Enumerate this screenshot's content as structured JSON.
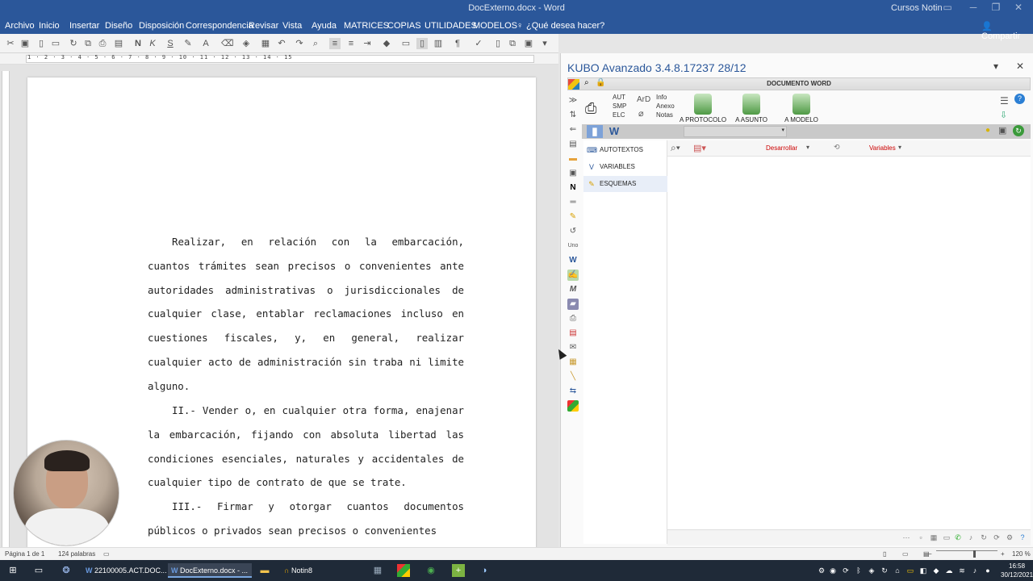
{
  "window": {
    "title": "DocExterno.docx - Word",
    "user": "Cursos Notin",
    "share": "Compartir"
  },
  "ribbon_tabs": [
    "Archivo",
    "Inicio",
    "Insertar",
    "Diseño",
    "Disposición",
    "Correspondencia",
    "Revisar",
    "Vista",
    "Ayuda",
    "MATRICES",
    "COPIAS",
    "UTILIDADES",
    "MODELOS",
    "¿Qué desea hacer?"
  ],
  "ruler_text": "1 · 2 · 3 · 4 · 5 · 6 · 7 · 8 · 9 · 10 · 11 · 12 · 13 · 14 · 15",
  "document": {
    "paragraphs": [
      "Realizar, en relación con la embarcación, cuantos trámites sean precisos o convenientes ante autoridades administrativas o jurisdiccionales de cualquier clase, entablar reclamaciones incluso en cuestiones fiscales, y, en general, realizar cualquier acto de administración sin traba ni limite alguno.",
      "II.- Vender o, en cualquier otra forma, enajenar la embarcación, fijando con absoluta libertad las condiciones esenciales, naturales y accidentales de cualquier tipo de contrato de que se trate.",
      "III.- Firmar y otorgar cuantos documentos públicos o privados sean precisos o convenientes"
    ]
  },
  "kubo": {
    "title": "KUBO Avanzado 3.4.8.17237   28/12",
    "header": "DOCUMENTO WORD",
    "small_labels": [
      "AUT",
      "SMP",
      "ELC"
    ],
    "info_labels": [
      "Info",
      "Anexo",
      "Notas"
    ],
    "big_buttons": [
      "A PROTOCOLO",
      "A ASUNTO",
      "A MODELO"
    ],
    "list_items": [
      {
        "label": "AUTOTEXTOS",
        "icon": "autotext-icon"
      },
      {
        "label": "VARIABLES",
        "icon": "variables-icon"
      },
      {
        "label": "ESQUEMAS",
        "icon": "schemes-icon"
      }
    ],
    "toolbar_labels": {
      "develop": "Desarrollar",
      "variables": "Variables"
    }
  },
  "status": {
    "page": "Página 1 de 1",
    "words": "124 palabras",
    "zoom": "120 %"
  },
  "taskbar": {
    "items": [
      "22100005.ACT.DOC...",
      "DocExterno.docx - ...",
      "Notin8"
    ],
    "time": "16:58",
    "date": "30/12/2021"
  },
  "colors": {
    "word_blue": "#2b579a",
    "taskbar": "#1f2a38",
    "accent_red": "#cc0000"
  }
}
